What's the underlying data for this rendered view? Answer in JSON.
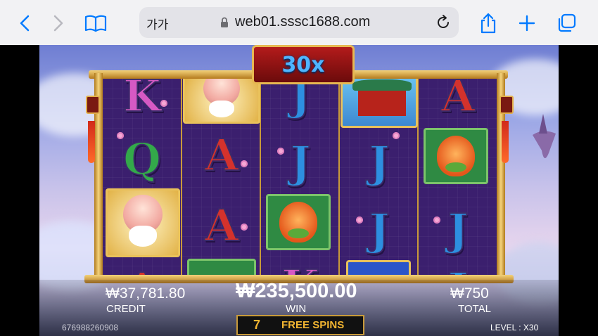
{
  "browser": {
    "text_size_label": "가가",
    "url": "web01.sssc1688.com"
  },
  "game": {
    "multiplier": "30x",
    "reels": [
      [
        "K",
        "Q",
        "elder",
        "A"
      ],
      [
        "elder",
        "A",
        "A",
        "peach"
      ],
      [
        "J",
        "J",
        "peach",
        "K"
      ],
      [
        "temple",
        "J",
        "J",
        "special"
      ],
      [
        "A",
        "peach",
        "J",
        "J"
      ]
    ],
    "credit_value": "₩37,781.80",
    "credit_label": "CREDIT",
    "win_value": "₩235,500.00",
    "win_label": "WIN",
    "total_value": "₩750",
    "total_label": "TOTAL",
    "free_spins_count": "7",
    "free_spins_label": "FREE SPINS",
    "player_id": "676988260908",
    "level_text": "LEVEL : X30"
  },
  "colors": {
    "url_bar": "#e3e3e8",
    "accent_blue": "#007aff",
    "reel_bg": "#3b1f6e",
    "gold": "#e7b851"
  }
}
